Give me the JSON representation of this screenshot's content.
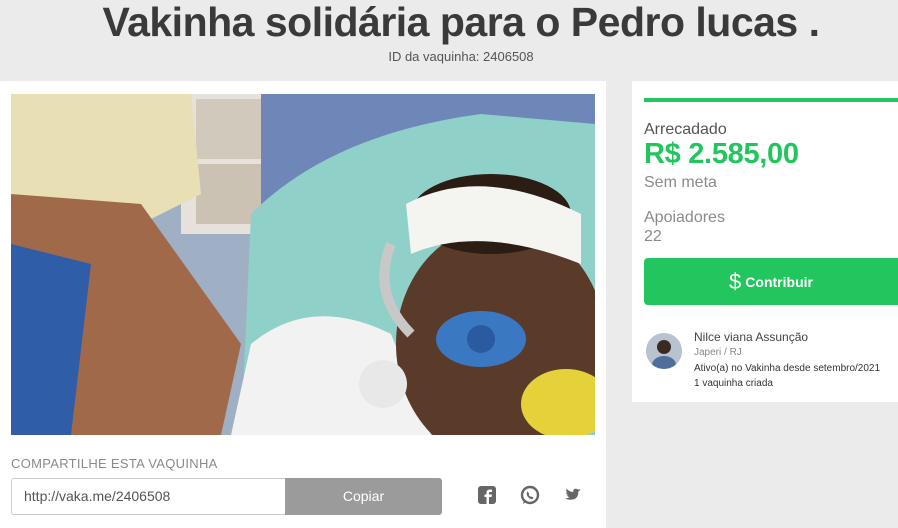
{
  "campaign": {
    "title": "Vakinha solidária para o Pedro lucas .",
    "id_label": "ID da vaquinha: 2406508"
  },
  "share": {
    "label": "COMPARTILHE ESTA VAQUINHA",
    "link": "http://vaka.me/2406508",
    "copy_label": "Copiar",
    "icons": [
      "facebook-icon",
      "whatsapp-icon",
      "twitter-icon"
    ]
  },
  "stats": {
    "raised_label": "Arrecadado",
    "raised_amount": "R$ 2.585,00",
    "goal_text": "Sem meta",
    "supporters_label": "Apoiadores",
    "supporters_count": "22",
    "progress_fraction": 1.0
  },
  "cta": {
    "label": "Contribuir",
    "icon": "dollar-icon"
  },
  "organizer": {
    "name": "Nilce viana Assunção",
    "location": "Japeri / RJ",
    "active_since": "Ativo(a) no Vakinha desde setembro/2021",
    "campaigns_created": "1 vaquinha criada"
  },
  "colors": {
    "accent": "#22c55e",
    "copy_button": "#9b9b9b",
    "background": "#ebebeb"
  }
}
